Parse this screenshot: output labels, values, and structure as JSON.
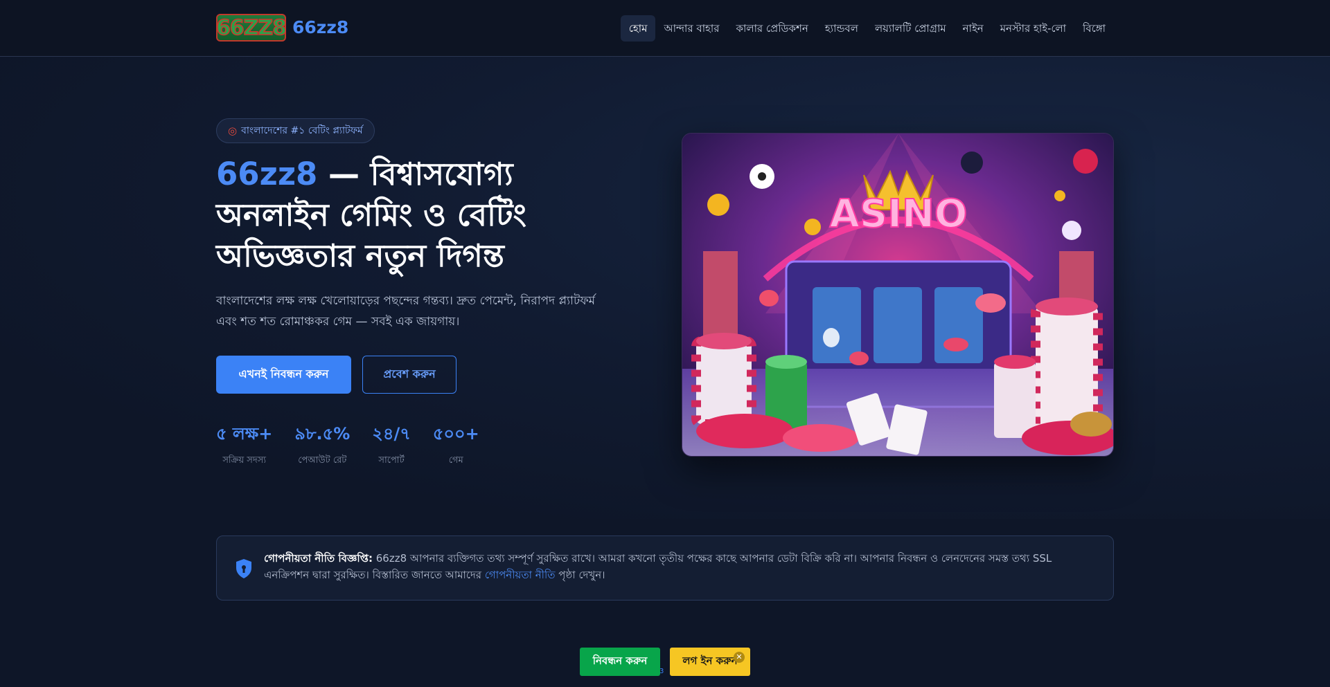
{
  "header": {
    "logo_text": "66ZZ8",
    "brand_name": "66zz8",
    "nav": [
      {
        "label": "হোম",
        "active": true
      },
      {
        "label": "আন্দার বাহার"
      },
      {
        "label": "কালার প্রেডিকশন"
      },
      {
        "label": "হ্যান্ডবল"
      },
      {
        "label": "লয়্যালটি প্রোগ্রাম"
      },
      {
        "label": "নাইন"
      },
      {
        "label": "মনস্টার হাই-লো"
      },
      {
        "label": "বিঙ্গো"
      }
    ]
  },
  "hero": {
    "badge_icon": "target-icon",
    "badge_text": "বাংলাদেশের #১ বেটিং প্ল্যাটফর্ম",
    "title_accent": "66zz8",
    "title_rest": " — বিশ্বাসযোগ্য অনলাইন গেমিং ও বেটিং অভিজ্ঞতার নতুন দিগন্ত",
    "subtitle": "বাংলাদেশের লক্ষ লক্ষ খেলোয়াড়ের পছন্দের গন্তব্য। দ্রুত পেমেন্ট, নিরাপদ প্ল্যাটফর্ম এবং শত শত রোমাঞ্চকর গেম — সবই এক জায়গায়।",
    "primary_button": "এখনই নিবন্ধন করুন",
    "secondary_button": "প্রবেশ করুন",
    "stats": [
      {
        "value": "৫ লক্ষ+",
        "label": "সক্রিয় সদস্য"
      },
      {
        "value": "৯৮.৫%",
        "label": "পেআউট রেট"
      },
      {
        "value": "২৪/৭",
        "label": "সাপোর্ট"
      },
      {
        "value": "৫০০+",
        "label": "গেম"
      }
    ],
    "image_sign": "ASINO"
  },
  "notice": {
    "icon": "shield-icon",
    "label": "গোপনীয়তা নীতি বিজ্ঞপ্তি:",
    "text_before": " 66zz8 আপনার ব্যক্তিগত তথ্য সম্পূর্ণ সুরক্ষিত রাখে। আমরা কখনো তৃতীয় পক্ষের কাছে আপনার ডেটা বিক্রি করি না। আপনার নিবন্ধন ও লেনদেনের সমস্ত তথ্য SSL এনক্রিপশন দ্বারা সুরক্ষিত। বিস্তারিত জানতে আমাদের ",
    "link": "গোপনীয়তা নীতি",
    "text_after": " পৃষ্ঠা দেখুন।"
  },
  "floating_bar": {
    "register": "নিবন্ধন করুন",
    "login": "লগ ইন করুন",
    "close": "✕",
    "tiny": "3"
  },
  "colors": {
    "accent": "#3b82f6",
    "register_green": "#08a54a",
    "login_yellow": "#f6c623",
    "background": "#0e1628"
  }
}
